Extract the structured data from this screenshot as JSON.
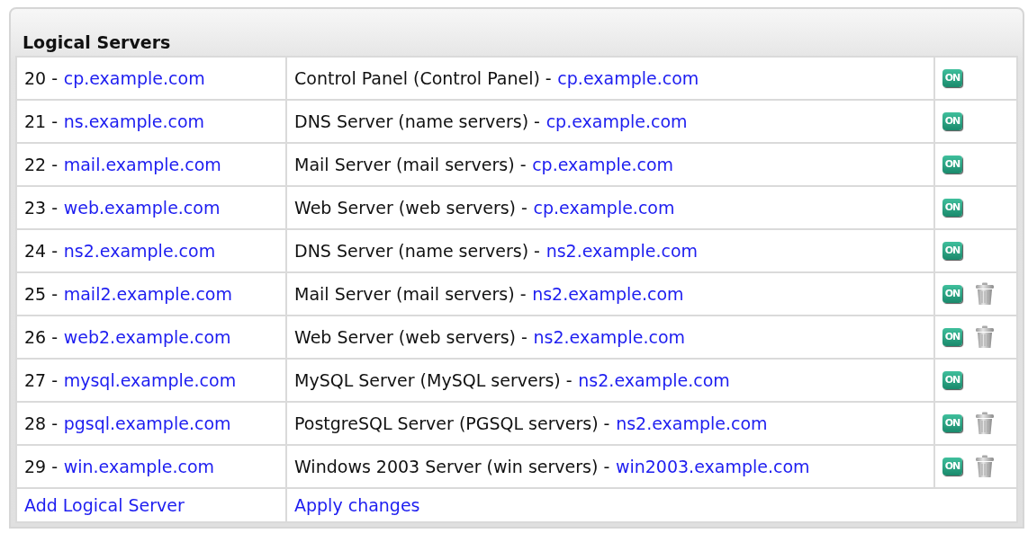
{
  "panel": {
    "title": "Logical Servers"
  },
  "rows": [
    {
      "number": "20 -",
      "host": "cp.example.com",
      "description": "Control Panel (Control Panel) -",
      "server_host": "cp.example.com",
      "status": "ON",
      "deletable": false
    },
    {
      "number": "21 -",
      "host": "ns.example.com",
      "description": "DNS Server (name servers) -",
      "server_host": "cp.example.com",
      "status": "ON",
      "deletable": false
    },
    {
      "number": "22 -",
      "host": "mail.example.com",
      "description": "Mail Server (mail servers) -",
      "server_host": "cp.example.com",
      "status": "ON",
      "deletable": false
    },
    {
      "number": "23 -",
      "host": "web.example.com",
      "description": "Web Server (web servers) -",
      "server_host": "cp.example.com",
      "status": "ON",
      "deletable": false
    },
    {
      "number": "24 -",
      "host": "ns2.example.com",
      "description": "DNS Server (name servers) -",
      "server_host": "ns2.example.com",
      "status": "ON",
      "deletable": false
    },
    {
      "number": "25 -",
      "host": "mail2.example.com",
      "description": "Mail Server (mail servers) -",
      "server_host": "ns2.example.com",
      "status": "ON",
      "deletable": true
    },
    {
      "number": "26 -",
      "host": "web2.example.com",
      "description": "Web Server (web servers) -",
      "server_host": "ns2.example.com",
      "status": "ON",
      "deletable": true
    },
    {
      "number": "27 -",
      "host": "mysql.example.com",
      "description": "MySQL Server (MySQL servers) -",
      "server_host": "ns2.example.com",
      "status": "ON",
      "deletable": false
    },
    {
      "number": "28 -",
      "host": "pgsql.example.com",
      "description": "PostgreSQL Server (PGSQL servers) -",
      "server_host": "ns2.example.com",
      "status": "ON",
      "deletable": true
    },
    {
      "number": "29 -",
      "host": "win.example.com",
      "description": "Windows 2003 Server (win servers) -",
      "server_host": "win2003.example.com",
      "status": "ON",
      "deletable": true
    }
  ],
  "footer": {
    "add_link": "Add Logical Server",
    "apply_link": "Apply changes"
  }
}
